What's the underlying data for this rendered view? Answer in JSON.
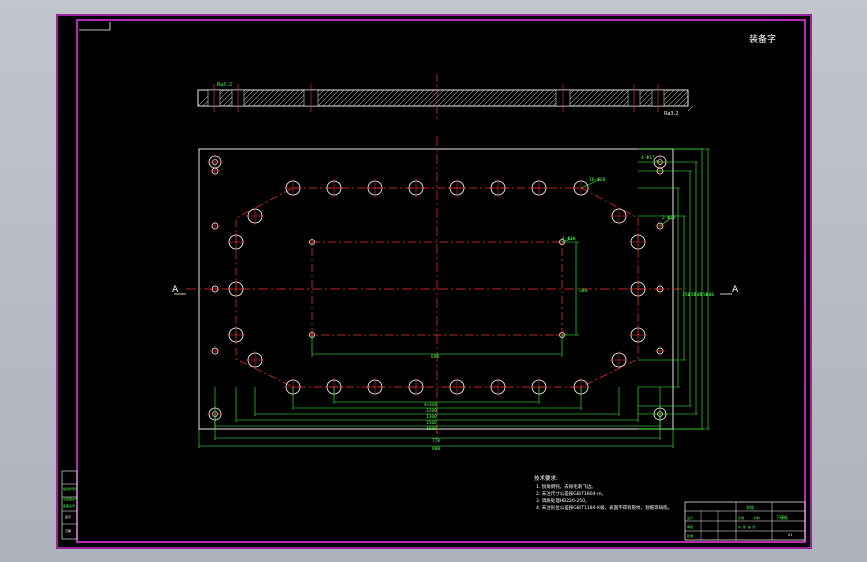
{
  "drawing": {
    "section_marker_letter": "A",
    "corner_mark": "装备字",
    "plan_top_label": "Ra3.2",
    "plan_side_label": "Ra3.2",
    "callout_hole_outer": "4-Φ17",
    "callout_hole_ring": "16-Φ28",
    "callout_hole_inner": "4-Φ10",
    "callout_side_holes": "2-Φ17",
    "dim_inner_width": "690",
    "dim_inner_height": "280",
    "dim_bottom_1": "4×100",
    "dim_bottom_2": "1200",
    "dim_bottom_3": "1300",
    "dim_bottom_4": "1500",
    "dim_bottom_5": "1600",
    "dim_overall_1": "770",
    "dim_overall_2": "800",
    "dim_right_1": "350",
    "dim_right_2": "450",
    "dim_right_3": "500",
    "dim_right_4": "550",
    "dim_right_5": "600"
  },
  "notes": {
    "title": "技术要求:",
    "items": [
      "1. 锐角倒钝，去除毛刺飞边。",
      "2. 未注尺寸公差按GB/T1804-m。",
      "3. 调质处理HB220-250。",
      "4. 未注形位公差按GB/T1184-K级，表面不得有裂纹、划痕等缺陷。"
    ]
  },
  "title_block": {
    "company": "学校",
    "drawing_name": "下模板",
    "scale_label": "比例",
    "material_label": "材料",
    "sheet_label": "共 张 第 张",
    "drawn_label": "设计",
    "checked_label": "审核",
    "approved_label": "批准",
    "drawing_no": "01"
  },
  "left_block": {
    "rows": [
      "借用件登记",
      "旧底图总号",
      "底图总号",
      "签字",
      "日期"
    ]
  },
  "colors": {
    "frame": "#ff3cff",
    "outline": "#ffffff",
    "centerline": "#ff3030",
    "dimension": "#3cff3c",
    "hatch": "#ffffff",
    "background": "#000000"
  }
}
